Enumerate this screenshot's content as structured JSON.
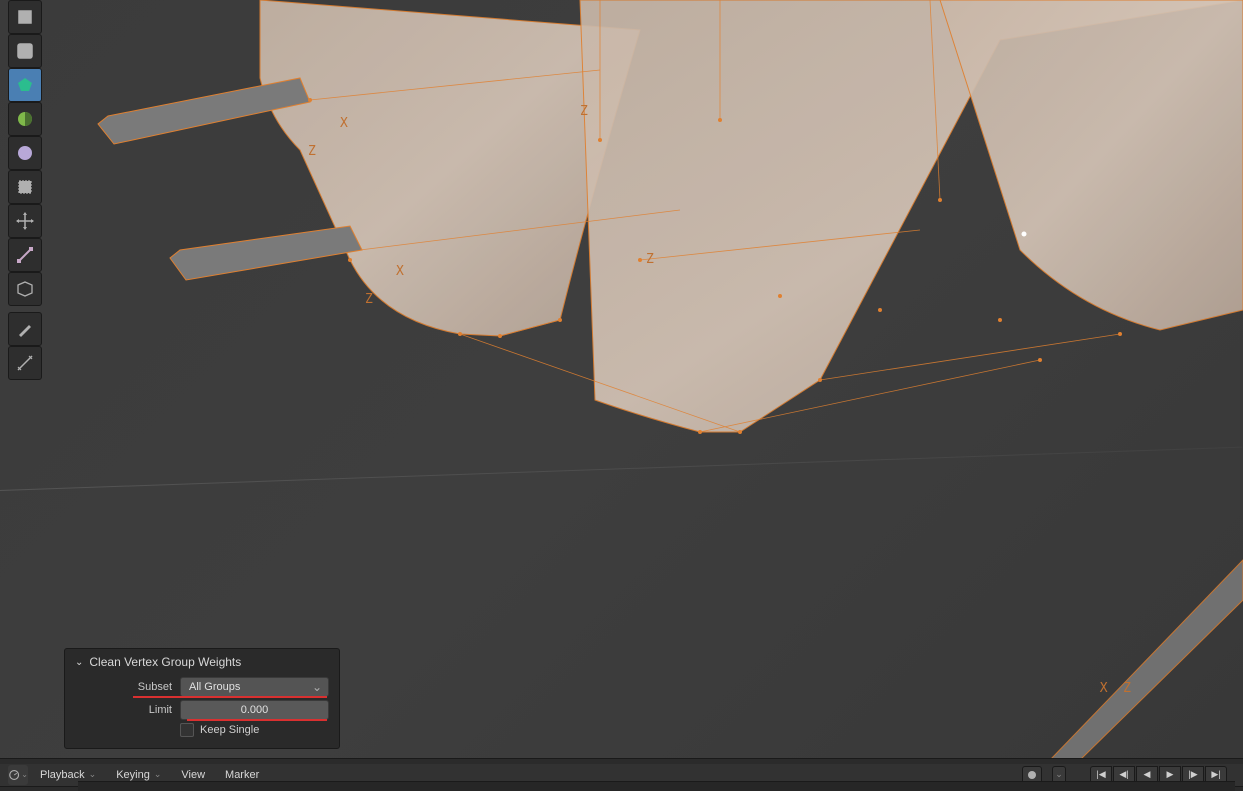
{
  "toolbar": {
    "tools": [
      {
        "name": "cube-tool"
      },
      {
        "name": "zoom-region-tool"
      },
      {
        "name": "face-set-tool"
      },
      {
        "name": "weight-gradient-tool"
      },
      {
        "name": "darken-tool"
      },
      {
        "name": "sample-tool"
      },
      {
        "name": "move-tool"
      },
      {
        "name": "edge-tool"
      },
      {
        "name": "poly-build-tool"
      },
      {
        "name": "annotate-tool"
      },
      {
        "name": "measure-tool"
      }
    ]
  },
  "operator": {
    "title": "Clean Vertex Group Weights",
    "subset_label": "Subset",
    "subset_value": "All Groups",
    "limit_label": "Limit",
    "limit_value": "0.000",
    "keep_single_label": "Keep Single"
  },
  "timeline": {
    "playback": "Playback",
    "keying": "Keying",
    "view": "View",
    "marker": "Marker"
  },
  "axes": {
    "z1": "Z",
    "z2": "Z",
    "z3": "Z",
    "z4": "Z",
    "x1": "X",
    "x2": "X",
    "x3": "X"
  }
}
